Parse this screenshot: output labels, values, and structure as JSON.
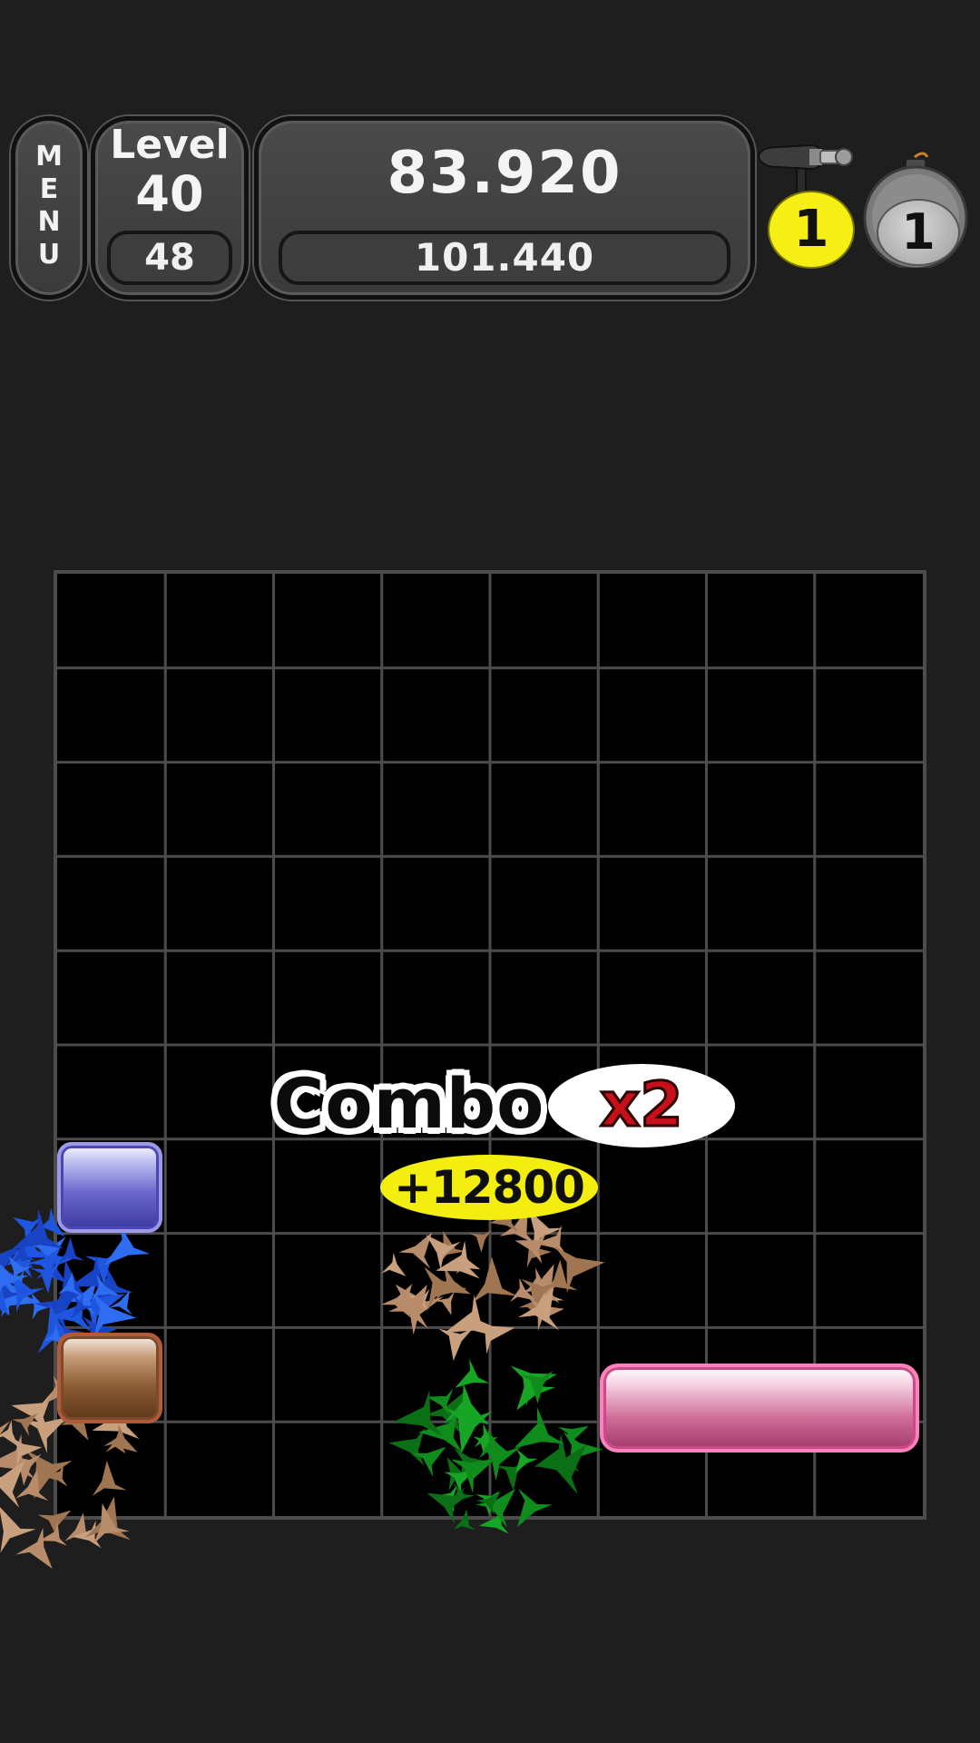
{
  "hud": {
    "menu_letters": [
      "M",
      "E",
      "N",
      "U"
    ],
    "level_label": "Level",
    "level_number": "40",
    "moves_remaining": "48",
    "score": "83.920",
    "target_score": "101.440"
  },
  "powerups": {
    "hammer": {
      "icon": "hammer-icon",
      "count": "1"
    },
    "bomb": {
      "icon": "bomb-icon",
      "count": "1"
    }
  },
  "board": {
    "columns": 8,
    "rows": 10
  },
  "combo": {
    "word": "Combo",
    "multiplier": "x2",
    "points": "+12800"
  },
  "colors": {
    "background": "#1e1e1e",
    "board": "#000000",
    "grid_line": "#4c4c4c",
    "block_blue": "#6d6acd",
    "block_brown": "#8a5a33",
    "block_pink": "#cf6d98",
    "points_badge": "#f3ee0f",
    "multiplier_text": "#c8101a"
  }
}
